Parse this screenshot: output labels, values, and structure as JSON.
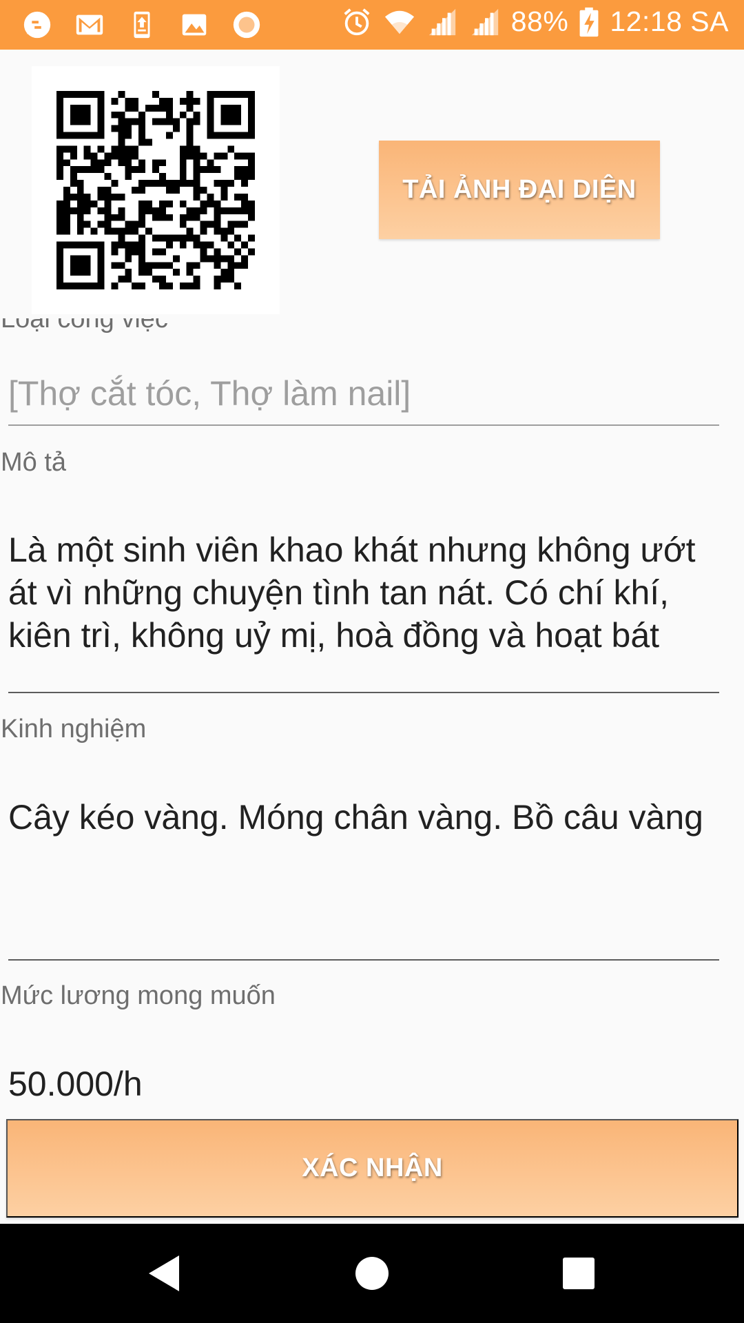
{
  "status_bar": {
    "battery": "88%",
    "time": "12:18 SA",
    "left_icons": [
      "chat-bubble-icon",
      "gmail-icon",
      "upload-icon",
      "image-icon",
      "record-icon"
    ],
    "right_icons": [
      "alarm-icon",
      "wifi-icon",
      "signal-icon",
      "signal-icon",
      "battery-charging-icon"
    ]
  },
  "profile": {
    "upload_button_label": "TẢI ẢNH ĐẠI DIỆN"
  },
  "form": {
    "job_type": {
      "label": "Loại công việc",
      "placeholder": "[Thợ cắt tóc, Thợ làm nail]"
    },
    "description": {
      "label": "Mô tả",
      "value": "Là một sinh viên khao khát nhưng không ướt át vì những chuyện tình tan nát. Có chí khí, kiên trì, không uỷ mị, hoà đồng và hoạt bát"
    },
    "experience": {
      "label": "Kinh nghiệm",
      "value": "Cây kéo vàng. Móng chân vàng. Bồ câu vàng"
    },
    "salary": {
      "label": "Mức lương mong muốn",
      "value": "50.000/h"
    },
    "confirm_label": "XÁC NHẬN"
  },
  "colors": {
    "status_bar": "#fb9b3e",
    "button_top": "#fab577",
    "button_bottom": "#fdd0a3"
  }
}
